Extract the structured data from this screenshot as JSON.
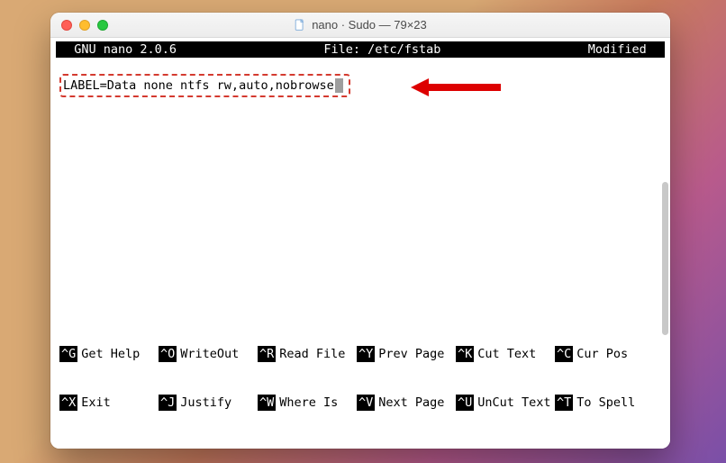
{
  "window": {
    "title": "nano · Sudo — 79×23"
  },
  "status": {
    "left": "  GNU nano 2.0.6",
    "center": "File: /etc/fstab",
    "right": "Modified  "
  },
  "editor": {
    "line1": "LABEL=Data none ntfs rw,auto,nobrowse"
  },
  "shortcuts": {
    "row1": [
      {
        "key": "^G",
        "label": "Get Help"
      },
      {
        "key": "^O",
        "label": "WriteOut"
      },
      {
        "key": "^R",
        "label": "Read File"
      },
      {
        "key": "^Y",
        "label": "Prev Page"
      },
      {
        "key": "^K",
        "label": "Cut Text"
      },
      {
        "key": "^C",
        "label": "Cur Pos"
      }
    ],
    "row2": [
      {
        "key": "^X",
        "label": "Exit"
      },
      {
        "key": "^J",
        "label": "Justify"
      },
      {
        "key": "^W",
        "label": "Where Is"
      },
      {
        "key": "^V",
        "label": "Next Page"
      },
      {
        "key": "^U",
        "label": "UnCut Text"
      },
      {
        "key": "^T",
        "label": "To Spell"
      }
    ]
  },
  "colors": {
    "highlight_border": "#d43a2f",
    "arrow": "#d00"
  }
}
